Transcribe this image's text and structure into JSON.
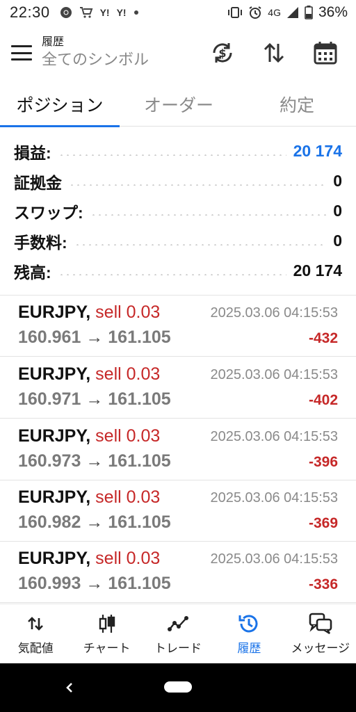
{
  "status_bar": {
    "time": "22:30",
    "network": "4G",
    "battery": "36%",
    "icons": [
      "chrome-icon",
      "cart-icon",
      "yahoo-icon",
      "yahoo-icon",
      "dot-icon",
      "alarm-icon",
      "signal-icon",
      "battery-icon"
    ],
    "yahoo_glyph": "Y!"
  },
  "appbar": {
    "title": "履歴",
    "subtitle": "全てのシンボル",
    "actions": [
      "currency-exchange-icon",
      "sort-icon",
      "calendar-icon"
    ]
  },
  "tabs": [
    {
      "label": "ポジション",
      "active": true
    },
    {
      "label": "オーダー",
      "active": false
    },
    {
      "label": "約定",
      "active": false
    }
  ],
  "summary": [
    {
      "label": "損益:",
      "value": "20 174",
      "accent": "#1a73e8"
    },
    {
      "label": "証拠金",
      "value": "0"
    },
    {
      "label": "スワップ:",
      "value": "0"
    },
    {
      "label": "手数料:",
      "value": "0"
    },
    {
      "label": "残高:",
      "value": "20 174"
    }
  ],
  "trades": [
    {
      "symbol": "EURJPY,",
      "side": "sell 0.03",
      "open": "160.961",
      "arrow": "→",
      "close": "161.105",
      "time": "2025.03.06 04:15:53",
      "profit": "-432"
    },
    {
      "symbol": "EURJPY,",
      "side": "sell 0.03",
      "open": "160.971",
      "arrow": "→",
      "close": "161.105",
      "time": "2025.03.06 04:15:53",
      "profit": "-402"
    },
    {
      "symbol": "EURJPY,",
      "side": "sell 0.03",
      "open": "160.973",
      "arrow": "→",
      "close": "161.105",
      "time": "2025.03.06 04:15:53",
      "profit": "-396"
    },
    {
      "symbol": "EURJPY,",
      "side": "sell 0.03",
      "open": "160.982",
      "arrow": "→",
      "close": "161.105",
      "time": "2025.03.06 04:15:53",
      "profit": "-369"
    },
    {
      "symbol": "EURJPY,",
      "side": "sell 0.03",
      "open": "160.993",
      "arrow": "→",
      "close": "161.105",
      "time": "2025.03.06 04:15:53",
      "profit": "-336"
    }
  ],
  "bottom_nav": [
    {
      "label": "気配値",
      "icon": "quotes-icon",
      "active": false
    },
    {
      "label": "チャート",
      "icon": "candlestick-icon",
      "active": false
    },
    {
      "label": "トレード",
      "icon": "trade-line-icon",
      "active": false
    },
    {
      "label": "履歴",
      "icon": "history-icon",
      "active": true
    },
    {
      "label": "メッセージ",
      "icon": "messages-icon",
      "active": false
    }
  ],
  "colors": {
    "accent_blue": "#1a73e8",
    "loss_red": "#c62828",
    "muted_gray": "#8a8a8a"
  }
}
